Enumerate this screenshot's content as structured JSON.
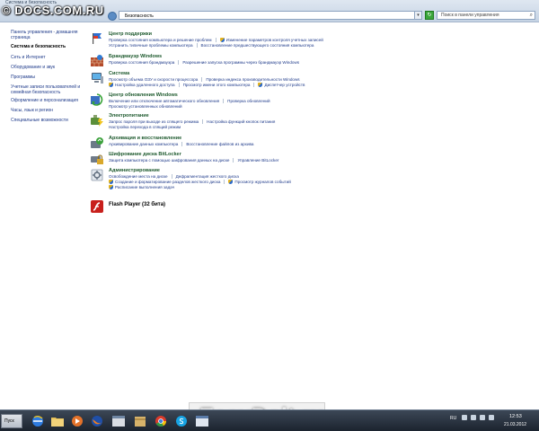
{
  "watermarks": {
    "top": "© DOCS.COM.RU",
    "bottom": "EasyDoit.ru"
  },
  "window": {
    "title": "Система и безопасность",
    "address": "Безопасность",
    "address_dropdown": "▾",
    "search_placeholder": "Поиск в панели управления"
  },
  "sidebar": {
    "items": [
      {
        "label": "Панель управления - домашняя страница"
      },
      {
        "label": "Система и безопасность"
      },
      {
        "label": "Сеть и Интернет"
      },
      {
        "label": "Оборудование и звук"
      },
      {
        "label": "Программы"
      },
      {
        "label": "Учетные записи пользователей и семейная безопасность"
      },
      {
        "label": "Оформление и персонализация"
      },
      {
        "label": "Часы, язык и регион"
      },
      {
        "label": "Специальные возможности"
      }
    ]
  },
  "categories": [
    {
      "title": "Центр поддержки",
      "icon": "flag-icon",
      "rows": [
        [
          "Проверка состояния компьютера и решение проблем",
          "Изменение параметров контроля учетных записей"
        ],
        [
          "Устранить типичные проблемы компьютера",
          "Восстановление предшествующего состояния компьютера"
        ]
      ]
    },
    {
      "title": "Брандмауэр Windows",
      "icon": "firewall-icon",
      "rows": [
        [
          "Проверка состояния брандмауэра",
          "Разрешение запуска программы через брандмауэр Windows"
        ]
      ]
    },
    {
      "title": "Система",
      "icon": "computer-icon",
      "rows": [
        [
          "Просмотр объема ОЗУ и скорости процессора",
          "Проверка индекса производительности Windows"
        ],
        [
          "Настройка удаленного доступа",
          "Просмотр имени этого компьютера",
          "Диспетчер устройств"
        ]
      ]
    },
    {
      "title": "Центр обновления Windows",
      "icon": "update-icon",
      "rows": [
        [
          "Включение или отключение автоматического обновления",
          "Проверка обновлений"
        ],
        [
          "Просмотр установленных обновлений"
        ]
      ]
    },
    {
      "title": "Электропитание",
      "icon": "power-icon",
      "rows": [
        [
          "Запрос пароля при выходе из спящего режима",
          "Настройка функций кнопок питания"
        ],
        [
          "Настройка перехода в спящий режим"
        ]
      ]
    },
    {
      "title": "Архивация и восстановление",
      "icon": "backup-icon",
      "rows": [
        [
          "Архивирование данных компьютера",
          "Восстановление файлов из архива"
        ]
      ]
    },
    {
      "title": "Шифрование диска BitLocker",
      "icon": "bitlocker-icon",
      "rows": [
        [
          "Защита компьютера с помощью шифрования данных на диске",
          "Управление BitLocker"
        ]
      ]
    },
    {
      "title": "Администрирование",
      "icon": "admin-tools-icon",
      "rows": [
        [
          "Освобождение места на диске",
          "Дефрагментация жесткого диска"
        ],
        [
          "Создание и форматирование разделов жесткого диска",
          "Просмотр журналов событий"
        ],
        [
          "Расписание выполнения задач"
        ]
      ]
    },
    {
      "title": "Flash Player (32 бита)",
      "icon": "flash-icon",
      "rows": []
    }
  ],
  "taskbar": {
    "start_label": "Пуск",
    "language": "RU",
    "time": "12:53",
    "date": "21.03.2012"
  }
}
